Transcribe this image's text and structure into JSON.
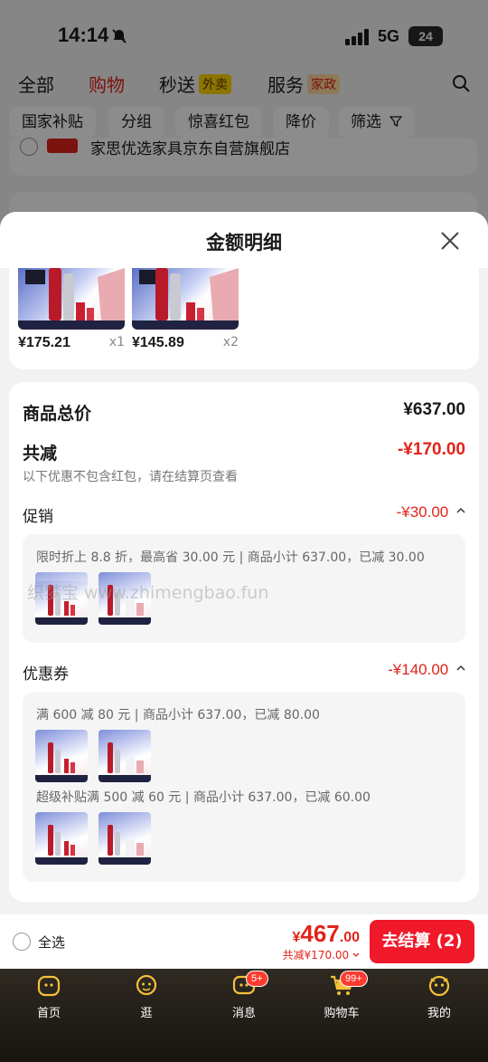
{
  "status_bar": {
    "time": "14:14",
    "network": "5G",
    "battery": "24"
  },
  "top_tabs": [
    {
      "label": "全部"
    },
    {
      "label": "购物",
      "active": true
    },
    {
      "label": "秒送",
      "tag": "外卖"
    },
    {
      "label": "服务",
      "tag": "家政"
    }
  ],
  "filters": [
    "国家补贴",
    "分组",
    "惊喜红包",
    "降价",
    "筛选"
  ],
  "background_store": "家思优选家具京东自营旗舰店",
  "sheet": {
    "title": "金额明细",
    "products": [
      {
        "price": "¥175.21",
        "qty": "x1"
      },
      {
        "price": "¥145.89",
        "qty": "x2"
      }
    ],
    "total_label": "商品总价",
    "total_amount": "¥637.00",
    "reduce_label": "共减",
    "reduce_amount": "-¥170.00",
    "reduce_note": "以下优惠不包含红包，请在结算页查看",
    "promotion": {
      "label": "促销",
      "amount": "-¥30.00",
      "line": "限时折上 8.8 折，最高省 30.00 元 | 商品小计 637.00，已减 30.00"
    },
    "coupon": {
      "label": "优惠券",
      "amount": "-¥140.00",
      "line1": "满 600 减 80 元 | 商品小计 637.00，已减 80.00",
      "line2": "超级补贴满 500 减 60 元 | 商品小计 637.00，已减 60.00"
    }
  },
  "watermark": "织梦宝 www.zhimengbao.fun",
  "checkout": {
    "select_all": "全选",
    "total_symbol": "¥",
    "total_int": "467",
    "total_dec": ".00",
    "saved": "共减¥170.00",
    "button": "去结算 (2)"
  },
  "bottom_nav": [
    {
      "label": "首页"
    },
    {
      "label": "逛"
    },
    {
      "label": "消息",
      "badge": "5+"
    },
    {
      "label": "购物车",
      "badge": "99+"
    },
    {
      "label": "我的"
    }
  ],
  "colors": {
    "accent": "#e2231a",
    "checkout": "#f0192a",
    "nav_bg": "#171410"
  }
}
